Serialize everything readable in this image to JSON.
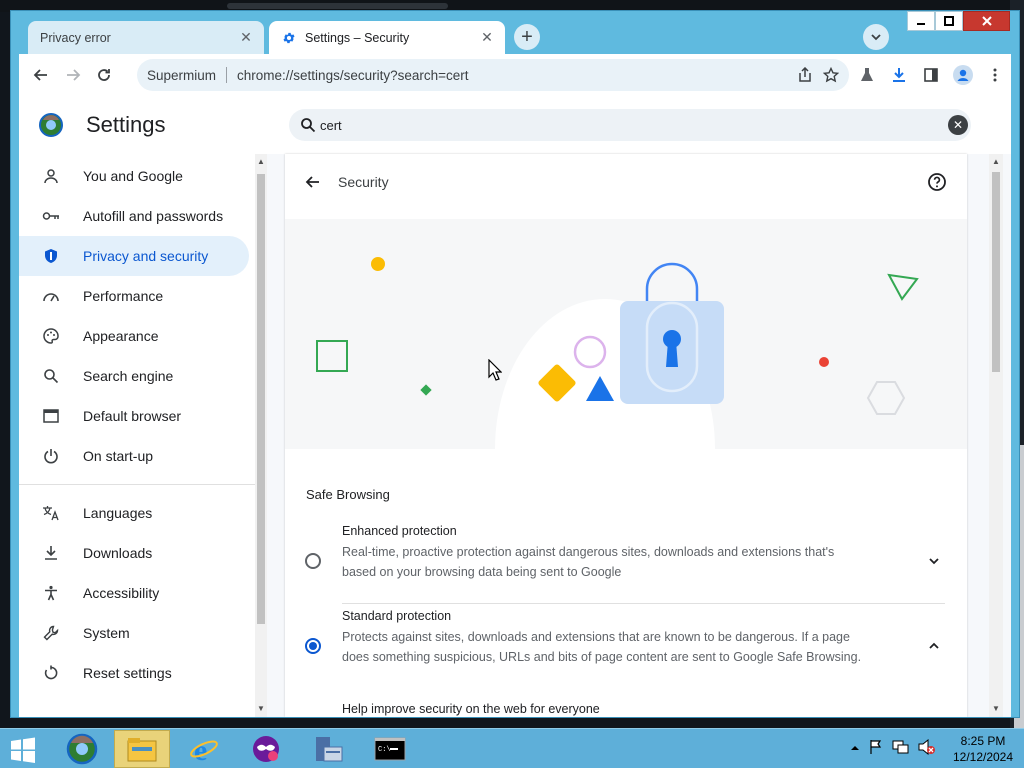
{
  "browser": {
    "tabs": [
      {
        "label": "Privacy error",
        "active": false
      },
      {
        "label": "Settings – Security",
        "active": true
      }
    ],
    "omnibox": {
      "site": "Supermium",
      "url": "chrome://settings/security?search=cert"
    }
  },
  "settings": {
    "title": "Settings",
    "search_value": "cert",
    "sidebar": [
      {
        "label": "You and Google",
        "icon": "person-icon"
      },
      {
        "label": "Autofill and passwords",
        "icon": "key-icon"
      },
      {
        "label": "Privacy and security",
        "icon": "shield-icon",
        "selected": true
      },
      {
        "label": "Performance",
        "icon": "gauge-icon"
      },
      {
        "label": "Appearance",
        "icon": "palette-icon"
      },
      {
        "label": "Search engine",
        "icon": "search-icon"
      },
      {
        "label": "Default browser",
        "icon": "browser-window-icon"
      },
      {
        "label": "On start-up",
        "icon": "power-icon"
      },
      {
        "label": "Languages",
        "icon": "translate-icon"
      },
      {
        "label": "Downloads",
        "icon": "download-icon"
      },
      {
        "label": "Accessibility",
        "icon": "accessibility-icon"
      },
      {
        "label": "System",
        "icon": "wrench-icon"
      },
      {
        "label": "Reset settings",
        "icon": "reset-icon"
      }
    ],
    "page_title": "Security",
    "section_label": "Safe Browsing",
    "options": [
      {
        "title": "Enhanced protection",
        "desc_line1": "Real-time, proactive protection against dangerous sites, downloads and extensions that's",
        "desc_line2": "based on your browsing data being sent to Google",
        "checked": false,
        "expanded": false
      },
      {
        "title": "Standard protection",
        "desc_line1": "Protects against sites, downloads and extensions that are known to be dangerous. If a page",
        "desc_line2": "does something suspicious, URLs and bits of page content are sent to Google Safe Browsing.",
        "checked": true,
        "expanded": true
      }
    ],
    "cut_text": "Help improve security on the web for everyone"
  },
  "taskbar": {
    "time": "8:25 PM",
    "date": "12/12/2024"
  },
  "colors": {
    "accent": "#0b57d0",
    "frame": "#5fbadf",
    "taskbar": "#5eafd9"
  }
}
